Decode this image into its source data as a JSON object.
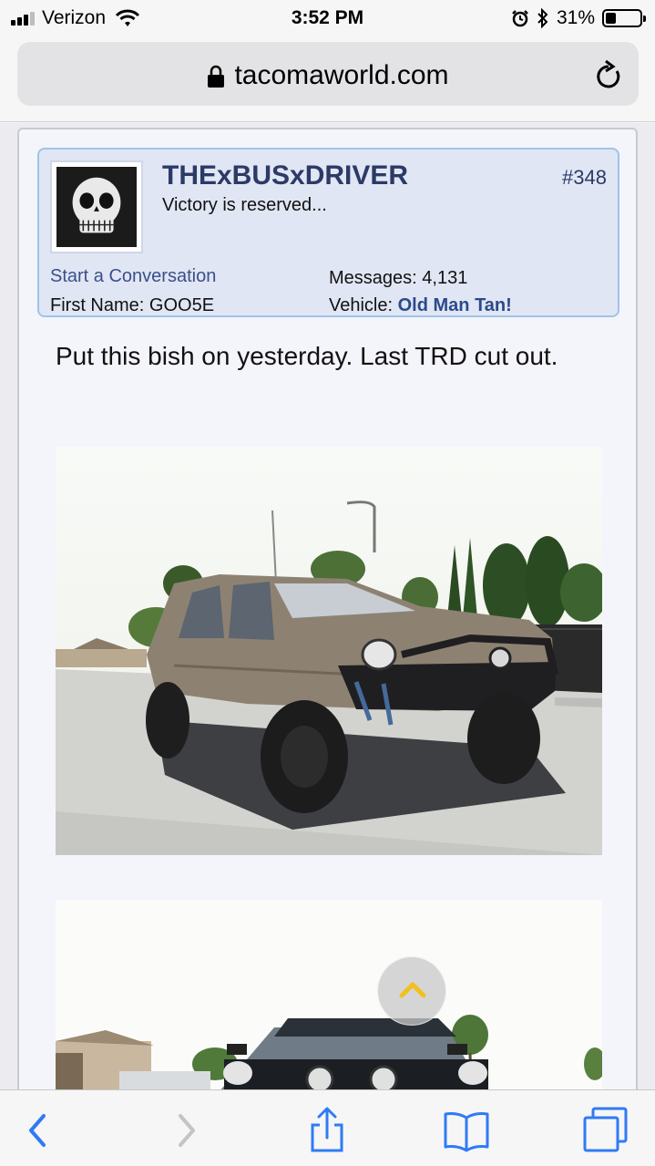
{
  "status_bar": {
    "carrier": "Verizon",
    "time": "3:52 PM",
    "battery_percent": "31%",
    "battery_level": 0.31,
    "icons": [
      "signal-icon",
      "wifi-icon",
      "alarm-icon",
      "bluetooth-icon",
      "battery-icon"
    ]
  },
  "browser": {
    "url": "tacomaworld.com",
    "icons": [
      "lock-icon",
      "reload-icon"
    ]
  },
  "post": {
    "username": "THExBUSxDRIVER",
    "user_title": "Victory is reserved...",
    "post_number": "#348",
    "start_conversation": "Start a Conversation",
    "first_name_label": "First Name:",
    "first_name_value": "GOO5E",
    "messages_label": "Messages:",
    "messages_value": "4,131",
    "vehicle_label": "Vehicle:",
    "vehicle_value": "Old Man Tan!",
    "body": "Put this bish on yesterday. Last TRD cut out."
  },
  "toolbar": {
    "icons": [
      "back-icon",
      "forward-icon",
      "share-icon",
      "bookmarks-icon",
      "tabs-icon"
    ]
  },
  "colors": {
    "accent": "#2f7bf5",
    "username": "#2b3a66",
    "userbox_bg": "#e1e6f4",
    "userbox_border": "#9fc4e8"
  }
}
